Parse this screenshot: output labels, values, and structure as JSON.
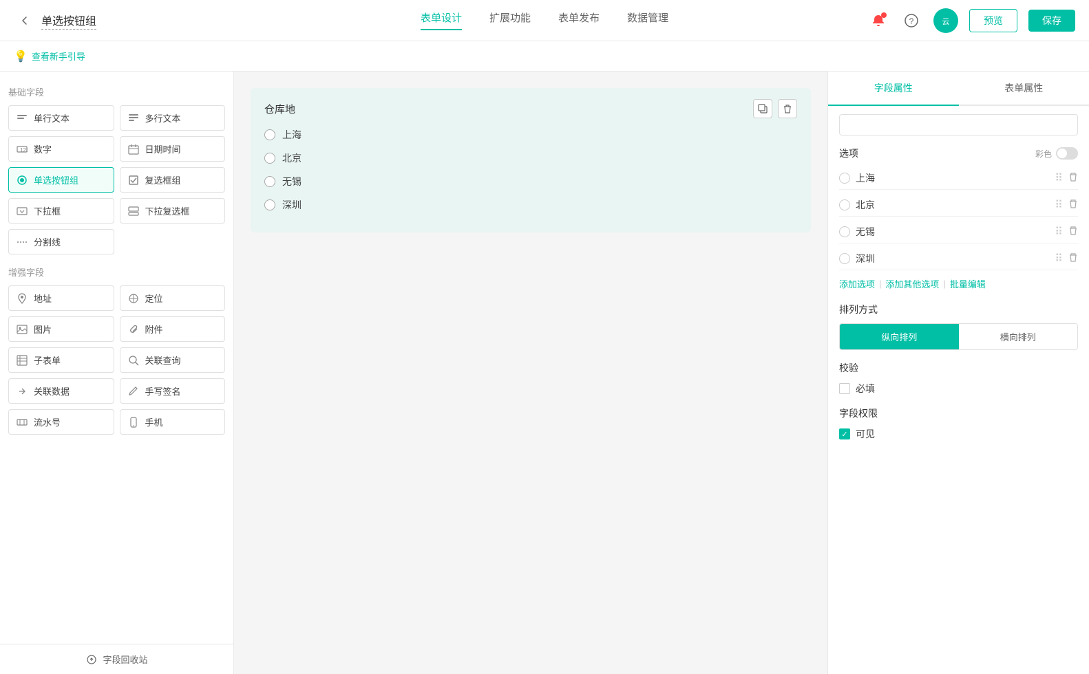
{
  "header": {
    "back_icon": "◀",
    "title": "单选按钮组",
    "nav": [
      {
        "label": "表单设计",
        "active": true
      },
      {
        "label": "扩展功能",
        "active": false
      },
      {
        "label": "表单发布",
        "active": false
      },
      {
        "label": "数据管理",
        "active": false
      }
    ],
    "preview_label": "预览",
    "save_label": "保存"
  },
  "guide": {
    "icon": "💡",
    "link_text": "查看新手引导"
  },
  "left_panel": {
    "basic_section_title": "基础字段",
    "enhanced_section_title": "增强字段",
    "basic_fields": [
      {
        "icon": "▤",
        "label": "单行文本"
      },
      {
        "icon": "▣",
        "label": "多行文本"
      },
      {
        "icon": "⊞",
        "label": "数字"
      },
      {
        "icon": "📅",
        "label": "日期时间"
      },
      {
        "icon": "◉",
        "label": "单选按钮组",
        "active": true
      },
      {
        "icon": "☑",
        "label": "复选框组"
      },
      {
        "icon": "▽",
        "label": "下拉框"
      },
      {
        "icon": "▽▽",
        "label": "下拉复选框"
      },
      {
        "icon": "—",
        "label": "分割线"
      }
    ],
    "enhanced_fields": [
      {
        "icon": "📍",
        "label": "地址"
      },
      {
        "icon": "◎",
        "label": "定位"
      },
      {
        "icon": "🖼",
        "label": "图片"
      },
      {
        "icon": "📎",
        "label": "附件"
      },
      {
        "icon": "≡",
        "label": "子表单"
      },
      {
        "icon": "🔍",
        "label": "关联查询"
      },
      {
        "icon": "🔗",
        "label": "关联数据"
      },
      {
        "icon": "✍",
        "label": "手写签名"
      },
      {
        "icon": "≋",
        "label": "流水号"
      },
      {
        "icon": "📱",
        "label": "手机"
      }
    ],
    "recycle_label": "字段回收站"
  },
  "canvas": {
    "field_label": "仓库地",
    "options": [
      "上海",
      "北京",
      "无锡",
      "深圳"
    ]
  },
  "right_panel": {
    "tab_field": "字段属性",
    "tab_form": "表单属性",
    "search_placeholder": "",
    "options_label": "选项",
    "color_label": "彩色",
    "options": [
      {
        "label": "上海"
      },
      {
        "label": "北京"
      },
      {
        "label": "无锡"
      },
      {
        "label": "深圳"
      }
    ],
    "add_option": "添加选项",
    "add_other": "添加其他选项",
    "batch_edit": "批量编辑",
    "sort_label": "排列方式",
    "sort_vertical": "纵向排列",
    "sort_horizontal": "横向排列",
    "validate_label": "校验",
    "required_label": "必填",
    "permission_label": "字段权限",
    "visible_label": "可见"
  }
}
